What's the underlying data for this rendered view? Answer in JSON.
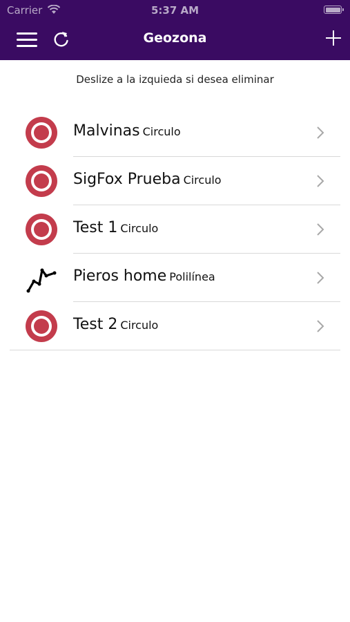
{
  "status_bar": {
    "carrier": "Carrier",
    "time": "5:37 AM"
  },
  "nav": {
    "title": "Geozona",
    "background": "#3a0b62"
  },
  "hint": "Deslize a la izquieda si desea eliminar",
  "geozones": [
    {
      "name": "Malvinas",
      "type": "Circulo",
      "icon": "circle-geofence-icon"
    },
    {
      "name": "SigFox Prueba",
      "type": "Circulo",
      "icon": "circle-geofence-icon"
    },
    {
      "name": "Test 1",
      "type": "Circulo",
      "icon": "circle-geofence-icon"
    },
    {
      "name": "Pieros home",
      "type": "Polilínea",
      "icon": "polyline-geofence-icon"
    },
    {
      "name": "Test 2",
      "type": "Circulo",
      "icon": "circle-geofence-icon"
    }
  ],
  "colors": {
    "accent": "#c33c4c",
    "separator": "#d8d8d8"
  }
}
